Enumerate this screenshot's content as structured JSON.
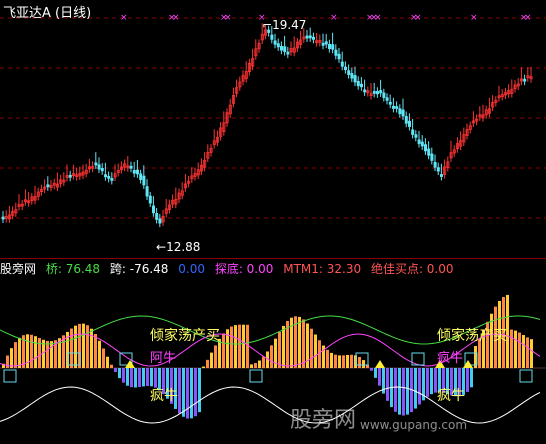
{
  "app": {
    "title": "飞亚达A (日线)"
  },
  "price_panel": {
    "high_label": "19.47",
    "low_label": "12.88"
  },
  "indicator_header": {
    "name": "股旁网",
    "qiao_label": "桥: 76.48",
    "kua_label": "跨: -76.48",
    "blank_value": "0.00",
    "tandi_label": "探底: 0.00",
    "mtm_label": "MTM1: 32.30",
    "jiajia_label": "绝佳买点: 0.00"
  },
  "annotations": {
    "left_big": "倾家荡产买",
    "left_small": "阿牛",
    "left_bottom": "疯牛",
    "right_big": "倾家荡产买",
    "right_small": "疯牛",
    "right_bottom": "疯牛"
  },
  "watermark": {
    "big": "股旁网",
    "url": "www.gupang.com"
  },
  "colors": {
    "up": "#ff3333",
    "down": "#5fe6f6",
    "grid": "#8b0000",
    "marker": "#ff44ff"
  }
}
